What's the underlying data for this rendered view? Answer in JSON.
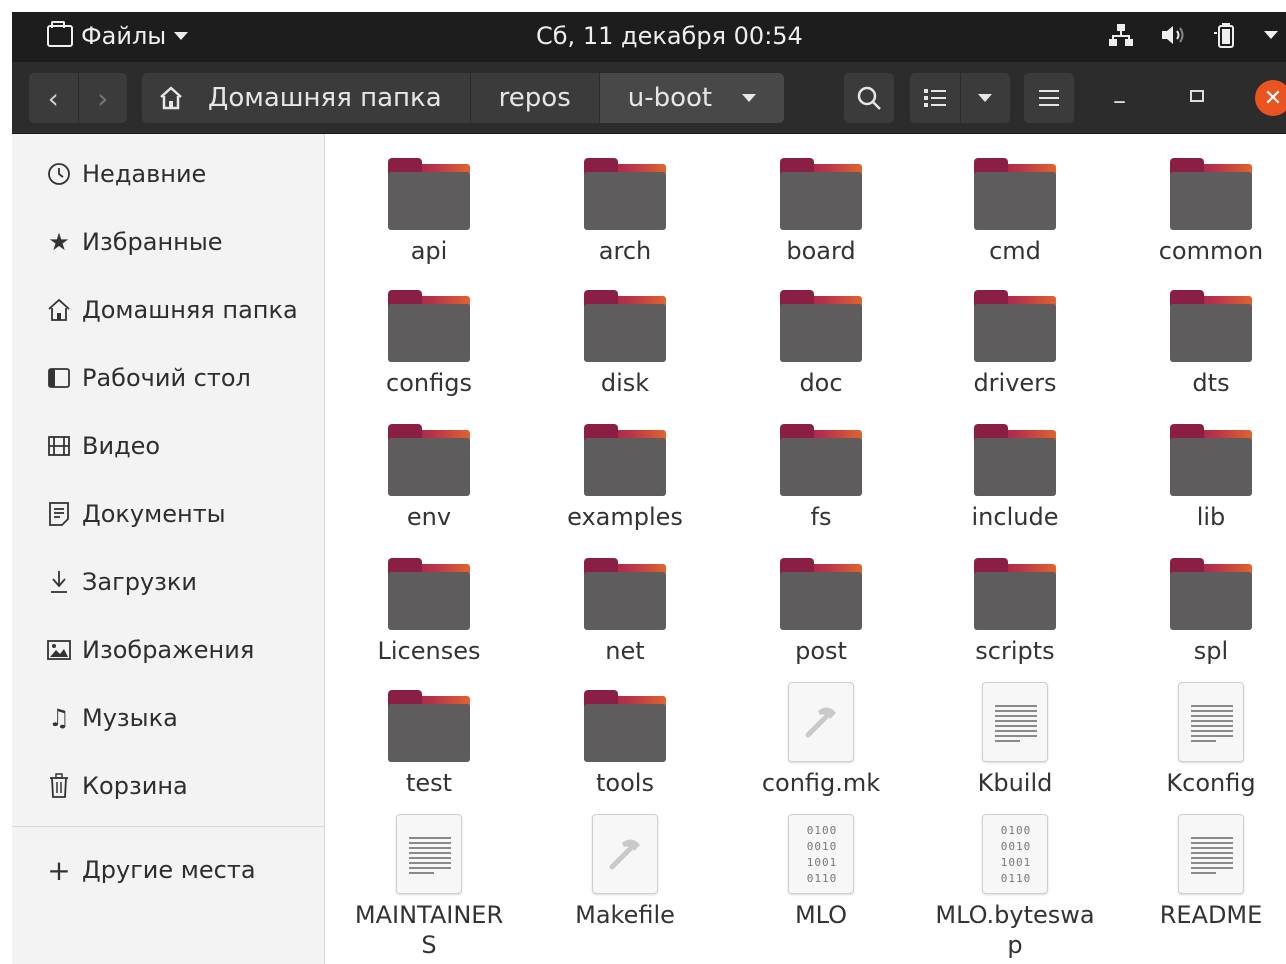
{
  "topbar": {
    "app_name": "Файлы",
    "clock": "Сб, 11 декабря  00:54"
  },
  "headerbar": {
    "path": [
      "Домашняя папка",
      "repos",
      "u-boot"
    ]
  },
  "sidebar": {
    "items": [
      {
        "label": "Недавние",
        "icon": "clock-icon"
      },
      {
        "label": "Избранные",
        "icon": "star-icon"
      },
      {
        "label": "Домашняя папка",
        "icon": "home-icon"
      },
      {
        "label": "Рабочий стол",
        "icon": "desktop-icon"
      },
      {
        "label": "Видео",
        "icon": "video-icon"
      },
      {
        "label": "Документы",
        "icon": "documents-icon"
      },
      {
        "label": "Загрузки",
        "icon": "download-icon"
      },
      {
        "label": "Изображения",
        "icon": "pictures-icon"
      },
      {
        "label": "Музыка",
        "icon": "music-icon"
      },
      {
        "label": "Корзина",
        "icon": "trash-icon"
      }
    ],
    "other": {
      "label": "Другие места",
      "icon": "plus-icon"
    }
  },
  "files": [
    {
      "name": "api",
      "type": "folder"
    },
    {
      "name": "arch",
      "type": "folder"
    },
    {
      "name": "board",
      "type": "folder"
    },
    {
      "name": "cmd",
      "type": "folder"
    },
    {
      "name": "common",
      "type": "folder"
    },
    {
      "name": "configs",
      "type": "folder"
    },
    {
      "name": "disk",
      "type": "folder"
    },
    {
      "name": "doc",
      "type": "folder"
    },
    {
      "name": "drivers",
      "type": "folder"
    },
    {
      "name": "dts",
      "type": "folder"
    },
    {
      "name": "env",
      "type": "folder"
    },
    {
      "name": "examples",
      "type": "folder"
    },
    {
      "name": "fs",
      "type": "folder"
    },
    {
      "name": "include",
      "type": "folder"
    },
    {
      "name": "lib",
      "type": "folder"
    },
    {
      "name": "Licenses",
      "type": "folder"
    },
    {
      "name": "net",
      "type": "folder"
    },
    {
      "name": "post",
      "type": "folder"
    },
    {
      "name": "scripts",
      "type": "folder"
    },
    {
      "name": "spl",
      "type": "folder"
    },
    {
      "name": "test",
      "type": "folder"
    },
    {
      "name": "tools",
      "type": "folder"
    },
    {
      "name": "config.mk",
      "type": "makefile"
    },
    {
      "name": "Kbuild",
      "type": "text"
    },
    {
      "name": "Kconfig",
      "type": "text"
    },
    {
      "name": "MAINTAINERS",
      "type": "text"
    },
    {
      "name": "Makefile",
      "type": "makefile"
    },
    {
      "name": "MLO",
      "type": "binary"
    },
    {
      "name": "MLO.byteswap",
      "type": "binary"
    },
    {
      "name": "README",
      "type": "text"
    }
  ],
  "binary_glyph": [
    "0100",
    "0010",
    "1001",
    "0110"
  ],
  "colors": {
    "accent": "#e95420",
    "folder_front": "#5e5c5d",
    "folder_back": "#8a1e45"
  }
}
